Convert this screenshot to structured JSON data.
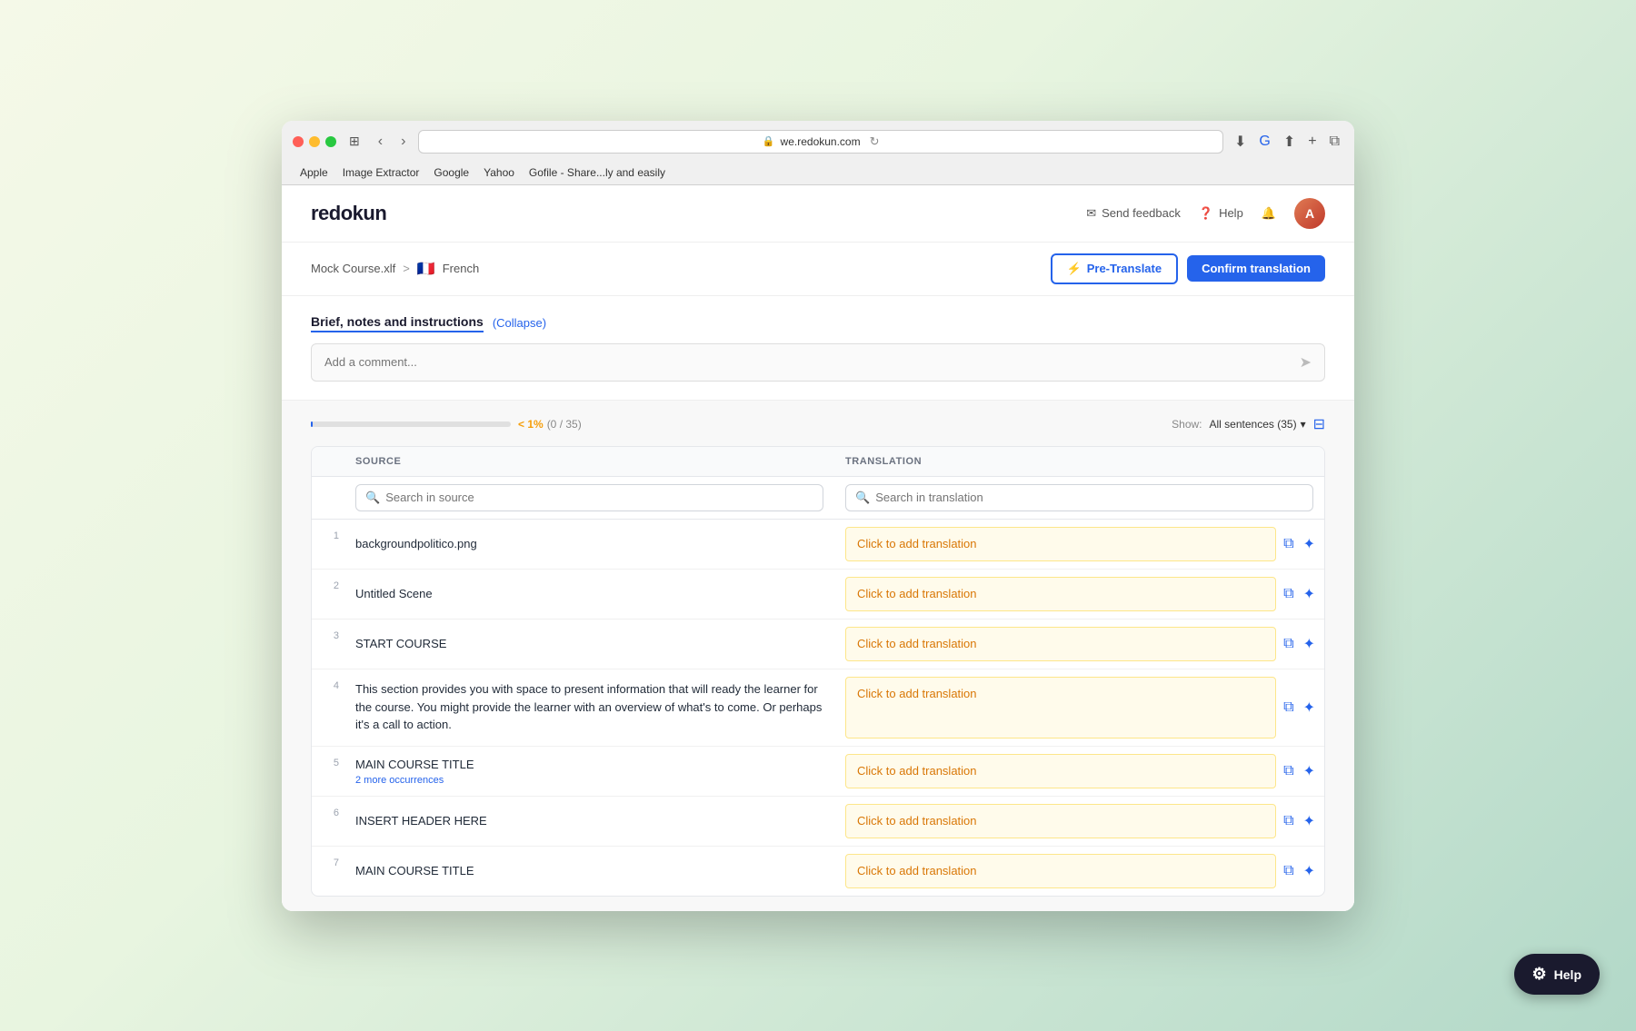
{
  "browser": {
    "url": "we.redokun.com",
    "bookmarks": [
      "Apple",
      "Image Extractor",
      "Google",
      "Yahoo",
      "Gofile - Share...ly and easily"
    ]
  },
  "app": {
    "logo": "redokun",
    "nav_actions": {
      "send_feedback": "Send feedback",
      "help": "Help"
    },
    "breadcrumb": {
      "file": "Mock Course.xlf",
      "separator": ">",
      "language": "French"
    },
    "buttons": {
      "pretranslate": "Pre-Translate",
      "confirm": "Confirm translation"
    },
    "brief": {
      "title": "Brief, notes and instructions",
      "collapse": "(Collapse)",
      "comment_placeholder": "Add a comment..."
    },
    "progress": {
      "percent": "< 1%",
      "fraction": "(0 / 35)",
      "bar_width": "1"
    },
    "show": {
      "label": "Show:",
      "value": "All sentences (35)"
    },
    "table": {
      "headers": [
        "SOURCE",
        "TRANSLATION"
      ],
      "search_source_placeholder": "Search in source",
      "search_translation_placeholder": "Search in translation",
      "rows": [
        {
          "num": "1",
          "source": "backgroundpolitico.png",
          "translation_placeholder": "Click to add translation",
          "occurrences": null
        },
        {
          "num": "2",
          "source": "Untitled Scene",
          "translation_placeholder": "Click to add translation",
          "occurrences": null
        },
        {
          "num": "3",
          "source": "START  COURSE",
          "translation_placeholder": "Click to add translation",
          "occurrences": null
        },
        {
          "num": "4",
          "source": "This section provides you with space to present information that will ready the learner for the course. You might provide the learner with an overview of what's to come. Or perhaps it's a call to action.",
          "translation_placeholder": "Click to add translation",
          "occurrences": null
        },
        {
          "num": "5",
          "source": "MAIN COURSE TITLE",
          "translation_placeholder": "Click to add translation",
          "occurrences": "2 more occurrences"
        },
        {
          "num": "6",
          "source": "INSERT HEADER HERE",
          "translation_placeholder": "Click to add translation",
          "occurrences": null
        },
        {
          "num": "7",
          "source": "MAIN COURSE TITLE",
          "translation_placeholder": "Click to add translation",
          "occurrences": null
        }
      ]
    }
  },
  "help_fab": {
    "label": "Help"
  }
}
